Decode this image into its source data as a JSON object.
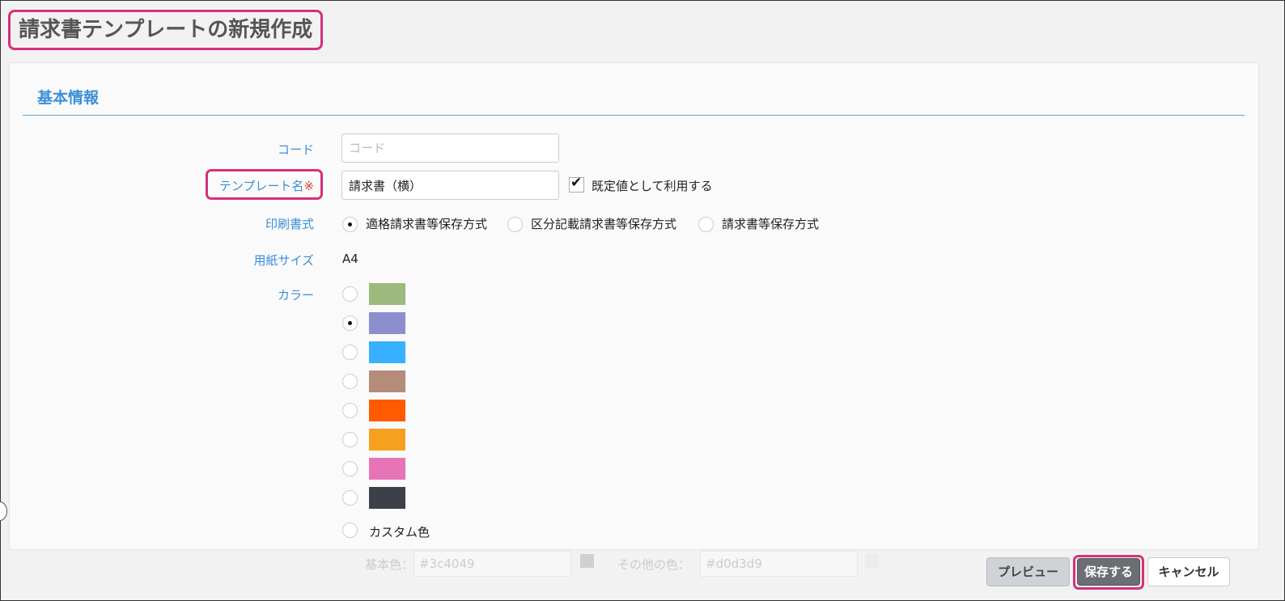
{
  "page": {
    "title": "請求書テンプレートの新規作成"
  },
  "section": {
    "title": "基本情報"
  },
  "form": {
    "code": {
      "label": "コード",
      "placeholder": "コード",
      "value": ""
    },
    "template_name": {
      "label": "テンプレート名",
      "required_mark": "※",
      "value": "請求書（横）",
      "default_checkbox_label": "既定値として利用する",
      "default_checked": true
    },
    "print_format": {
      "label": "印刷書式",
      "options": [
        "適格請求書等保存方式",
        "区分記載請求書等保存方式",
        "請求書等保存方式"
      ],
      "selected": "適格請求書等保存方式"
    },
    "paper_size": {
      "label": "用紙サイズ",
      "value": "A4"
    },
    "color": {
      "label": "カラー",
      "swatches": [
        "#9db97d",
        "#8c8fce",
        "#36b0ff",
        "#b58b7a",
        "#ff5a00",
        "#f6a020",
        "#e874b8",
        "#3c4049"
      ],
      "selected_index": 1,
      "custom_label": "カスタム色"
    },
    "custom_color": {
      "base_label": "基本色：",
      "base_value": "#3c4049",
      "other_label": "その他の色：",
      "other_value": "#d0d3d9"
    }
  },
  "buttons": {
    "preview": "プレビュー",
    "save": "保存する",
    "cancel": "キャンセル"
  }
}
